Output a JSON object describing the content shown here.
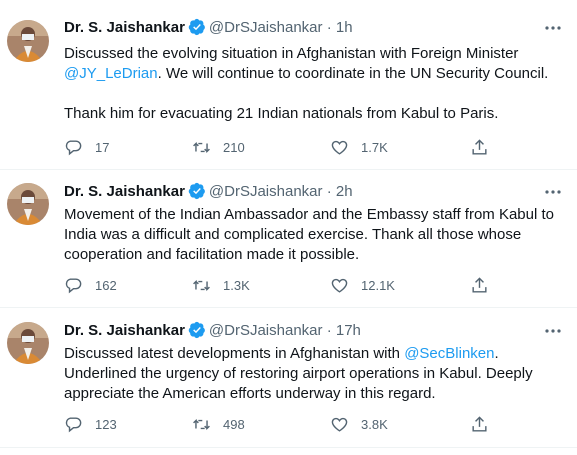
{
  "tweets": [
    {
      "author": "Dr. S. Jaishankar",
      "handle": "@DrSJaishankar",
      "time": "1h",
      "text_1a": "Discussed the evolving situation in Afghanistan with Foreign Minister",
      "mention_1": "@JY_LeDrian",
      "text_1b": ". We will continue to coordinate in the UN Security Council.",
      "text_2": "Thank him for evacuating 21 Indian nationals from Kabul to Paris.",
      "replies": "17",
      "retweets": "210",
      "likes": "1.7K"
    },
    {
      "author": "Dr. S. Jaishankar",
      "handle": "@DrSJaishankar",
      "time": "2h",
      "text_1a": "Movement of the Indian Ambassador and the Embassy staff from Kabul to India was a difficult and complicated exercise. Thank all those whose cooperation and facilitation made it possible.",
      "replies": "162",
      "retweets": "1.3K",
      "likes": "12.1K"
    },
    {
      "author": "Dr. S. Jaishankar",
      "handle": "@DrSJaishankar",
      "time": "17h",
      "text_1a": "Discussed latest developments in Afghanistan with ",
      "mention_1": "@SecBlinken",
      "text_1b": ". Underlined the urgency of restoring airport operations in Kabul. Deeply appreciate the American efforts underway in this regard.",
      "replies": "123",
      "retweets": "498",
      "likes": "3.8K"
    }
  ],
  "separator": "·",
  "icons": [
    "verified-badge-icon",
    "more-options-icon",
    "reply-icon",
    "retweet-icon",
    "like-icon",
    "share-icon"
  ],
  "colors": {
    "link": "#1d9bf0",
    "muted": "#536471",
    "divider": "#eff3f4"
  }
}
